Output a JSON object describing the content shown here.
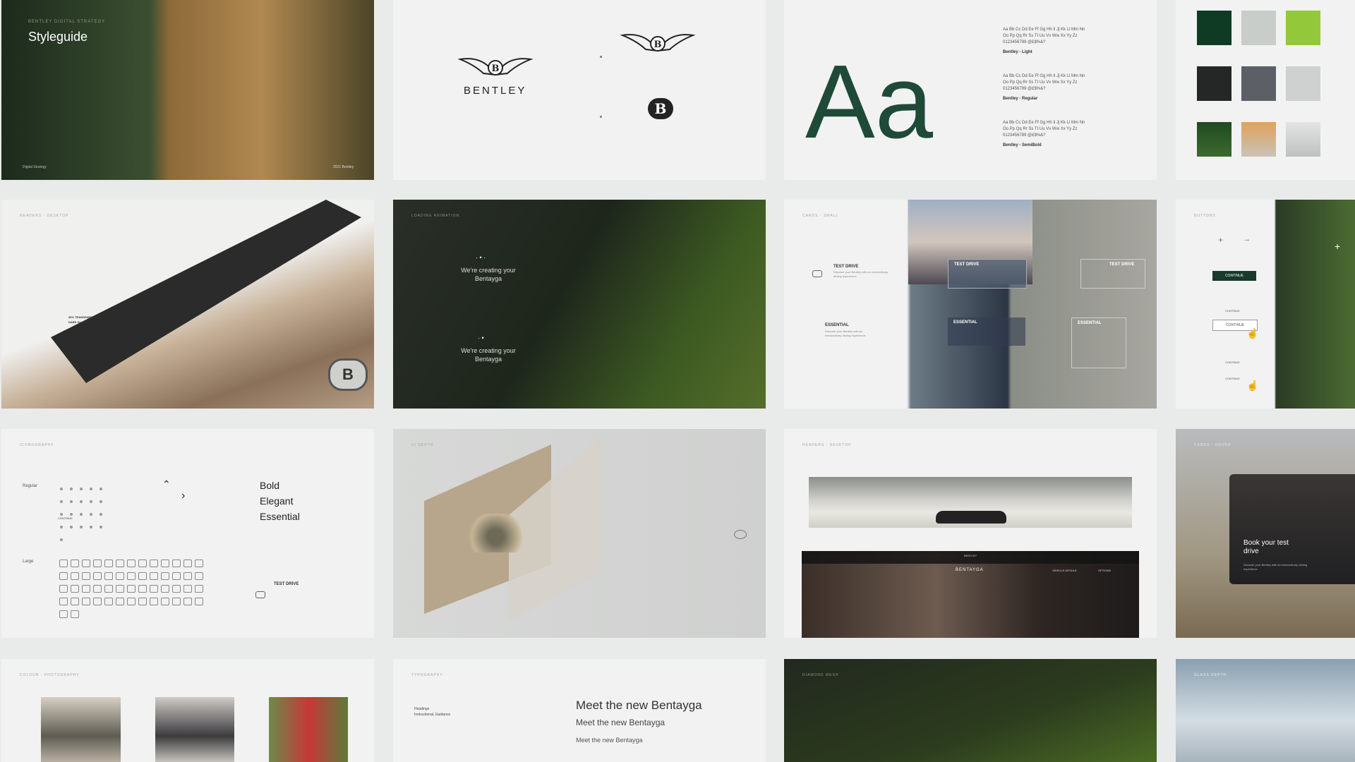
{
  "cover": {
    "eyebrow": "BENTLEY DIGITAL STRATEGY",
    "title": "Styleguide",
    "foot_left": "Digital Strategy",
    "foot_right": "2021 Bentley"
  },
  "logos": {
    "wordmark": "BENTLEY"
  },
  "typography": {
    "glyph": "Aa",
    "specimen_line1": "Aa Bb Cc Dd Ee Ff Gg Hh Ii Jj Kk Ll Mm Nn",
    "specimen_line2": "Oo Pp Qq Rr Ss Tt Uu Vv Ww Xx Yy Zz",
    "specimen_line3": "0123456789 @£$%&?",
    "weights": [
      "Bentley - Light",
      "Bentley - Regular",
      "Bentley - SemiBold"
    ]
  },
  "palette": {
    "colors": [
      "#0f3b24",
      "#c8cdca",
      "#93c83b",
      "#252626",
      "#5c5f66",
      "#cfd1d0",
      "#1f4a22",
      "#e0a25a",
      "#bfc1c0"
    ]
  },
  "headers": {
    "label": "HEADERS - DESKTOP",
    "line1": "90% TRANSPARENCY",
    "line2": "DARK GLASS"
  },
  "loading": {
    "label": "LOADING ANIMATION",
    "msg1": "We're creating your Bentayga",
    "msg2": "We're creating your Bentayga"
  },
  "cards": {
    "label": "CARDS - SMALL",
    "title1": "TEST DRIVE",
    "title2": "ESSENTIAL",
    "body": "Discover your Bentley with an extraordinary driving experience."
  },
  "buttons": {
    "label": "BUTTONS",
    "continue": "CONTINUE"
  },
  "icons": {
    "label": "ICONOGRAPHY",
    "regular": "Regular",
    "large": "Large",
    "continue": "CONTINUE",
    "words": [
      "Bold",
      "Elegant",
      "Essential"
    ],
    "test_drive": "TEST DRIVE"
  },
  "depth": {
    "label": "UI DEPTH"
  },
  "headers2": {
    "label": "HEADERS - DESKTOP",
    "model": "BENTAYGA",
    "sublogo": "BENTLEY",
    "vehicle": "VEHICLE DETAILS",
    "options": "OPTIONS"
  },
  "cta": {
    "label": "CARDS - HOVER",
    "title": "Book your test drive",
    "body": "Discover your Bentley with an extraordinary driving experience."
  },
  "photo": {
    "label": "COLOUR - PHOTOGRAPHY"
  },
  "type2": {
    "label": "TYPOGRAPHY",
    "headings": "Headings",
    "sub": "Instructional, Guidance",
    "h1": "Meet the new Bentayga",
    "h2": "Meet the new Bentayga",
    "h3": "Meet the new Bentayga"
  },
  "mesh": {
    "label": "DIAMOND MESH"
  },
  "glass": {
    "label": "GLASS DEPTH"
  }
}
